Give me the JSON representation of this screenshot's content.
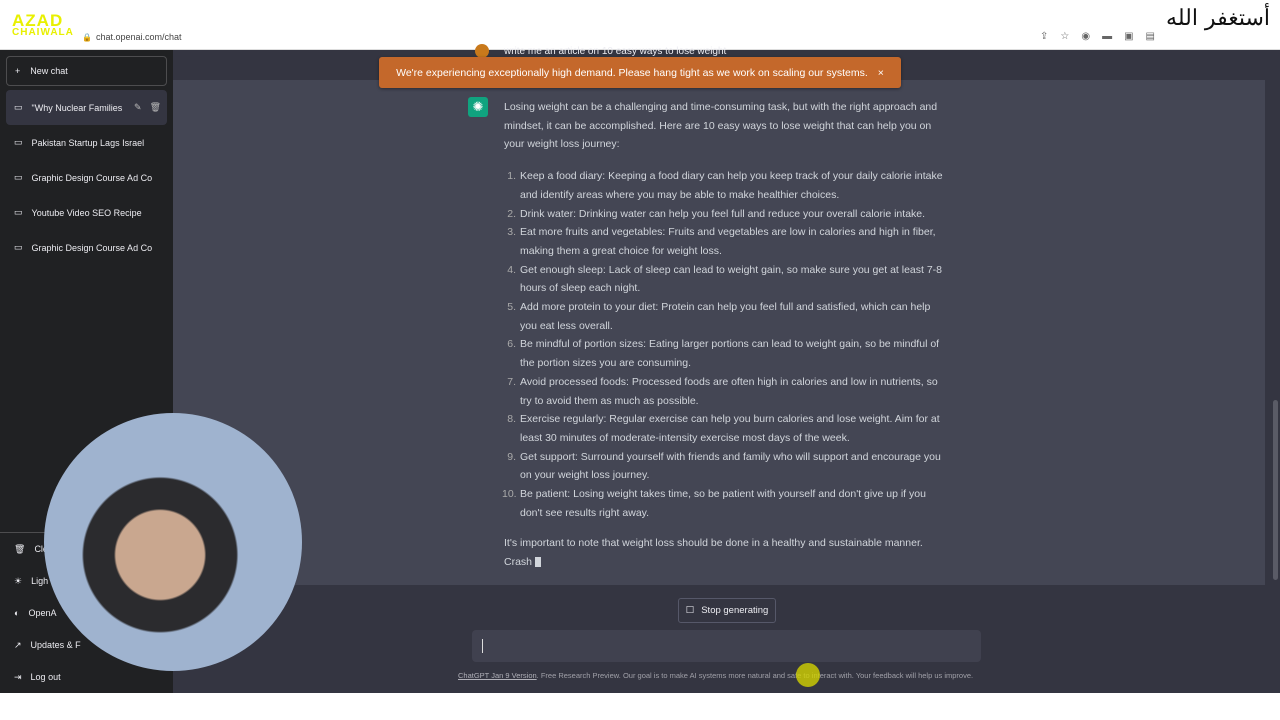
{
  "browser": {
    "url": "chat.openai.com/chat",
    "watermark": "AZAD CHAIWALA",
    "arabic": "أستغفر الله"
  },
  "sidebar": {
    "new_chat": "New chat",
    "conversations": [
      {
        "label": "\"Why Nuclear Families",
        "active": true
      },
      {
        "label": "Pakistan Startup Lags Israel"
      },
      {
        "label": "Graphic Design Course Ad Co"
      },
      {
        "label": "Youtube Video SEO Recipe"
      },
      {
        "label": "Graphic Design Course Ad Co"
      }
    ],
    "bottom": [
      {
        "label": "Cle",
        "icon": "trash-icon"
      },
      {
        "label": "Ligh",
        "icon": "sun-icon"
      },
      {
        "label": "OpenA",
        "icon": "discord-icon"
      },
      {
        "label": "Updates & F",
        "icon": "external-link-icon"
      },
      {
        "label": "Log out",
        "icon": "logout-icon"
      }
    ]
  },
  "banner": {
    "text": "We're experiencing exceptionally high demand. Please hang tight as we work on scaling our systems.",
    "close": "×",
    "color": "#c4682b"
  },
  "user_message": "write me an article on 10 easy ways to lose weight",
  "assistant": {
    "intro": "Losing weight can be a challenging and time-consuming task, but with the right approach and mindset, it can be accomplished. Here are 10 easy ways to lose weight that can help you on your weight loss journey:",
    "items": [
      "Keep a food diary: Keeping a food diary can help you keep track of your daily calorie intake and identify areas where you may be able to make healthier choices.",
      "Drink water: Drinking water can help you feel full and reduce your overall calorie intake.",
      "Eat more fruits and vegetables: Fruits and vegetables are low in calories and high in fiber, making them a great choice for weight loss.",
      "Get enough sleep: Lack of sleep can lead to weight gain, so make sure you get at least 7-8 hours of sleep each night.",
      "Add more protein to your diet: Protein can help you feel full and satisfied, which can help you eat less overall.",
      "Be mindful of portion sizes: Eating larger portions can lead to weight gain, so be mindful of the portion sizes you are consuming.",
      "Avoid processed foods: Processed foods are often high in calories and low in nutrients, so try to avoid them as much as possible.",
      "Exercise regularly: Regular exercise can help you burn calories and lose weight. Aim for at least 30 minutes of moderate-intensity exercise most days of the week.",
      "Get support: Surround yourself with friends and family who will support and encourage you on your weight loss journey.",
      "Be patient: Losing weight takes time, so be patient with yourself and don't give up if you don't see results right away."
    ],
    "outro": "It's important to note that weight loss should be done in a healthy and sustainable manner. Crash"
  },
  "stop_button": "Stop generating",
  "input": {
    "value": ""
  },
  "footer": {
    "link": "ChatGPT Jan 9 Version",
    "text": ". Free Research Preview. Our goal is to make AI systems more natural and safe to interact with. Your feedback will help us improve."
  }
}
